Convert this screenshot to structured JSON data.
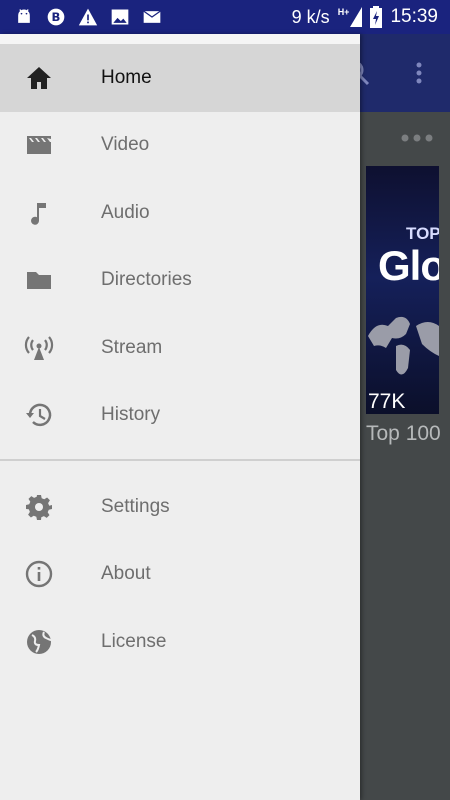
{
  "status_bar": {
    "speed": "9 k/s",
    "network": "H+",
    "time": "15:39",
    "left_icons": [
      "android-icon",
      "b-circle-icon",
      "warning-icon",
      "image-icon",
      "mail-icon"
    ]
  },
  "background": {
    "thumbnail_top_text": "TOP",
    "thumbnail_title": "Glo",
    "thumbnail_views": "77K",
    "thumbnail_caption": "Top 100"
  },
  "drawer": {
    "primary_items": [
      {
        "label": "Home",
        "icon": "home-icon",
        "selected": true
      },
      {
        "label": "Video",
        "icon": "movie-icon",
        "selected": false
      },
      {
        "label": "Audio",
        "icon": "music-note-icon",
        "selected": false
      },
      {
        "label": "Directories",
        "icon": "folder-icon",
        "selected": false
      },
      {
        "label": "Stream",
        "icon": "stream-antenna-icon",
        "selected": false
      },
      {
        "label": "History",
        "icon": "history-icon",
        "selected": false
      }
    ],
    "secondary_items": [
      {
        "label": "Settings",
        "icon": "settings-gear-icon"
      },
      {
        "label": "About",
        "icon": "info-icon"
      },
      {
        "label": "License",
        "icon": "globe-icon"
      }
    ]
  },
  "colors": {
    "status_bar": "#1a237e",
    "toolbar": "#1f2a6b",
    "drawer_bg": "#eeeeee",
    "selected_bg": "#d6d6d6"
  }
}
